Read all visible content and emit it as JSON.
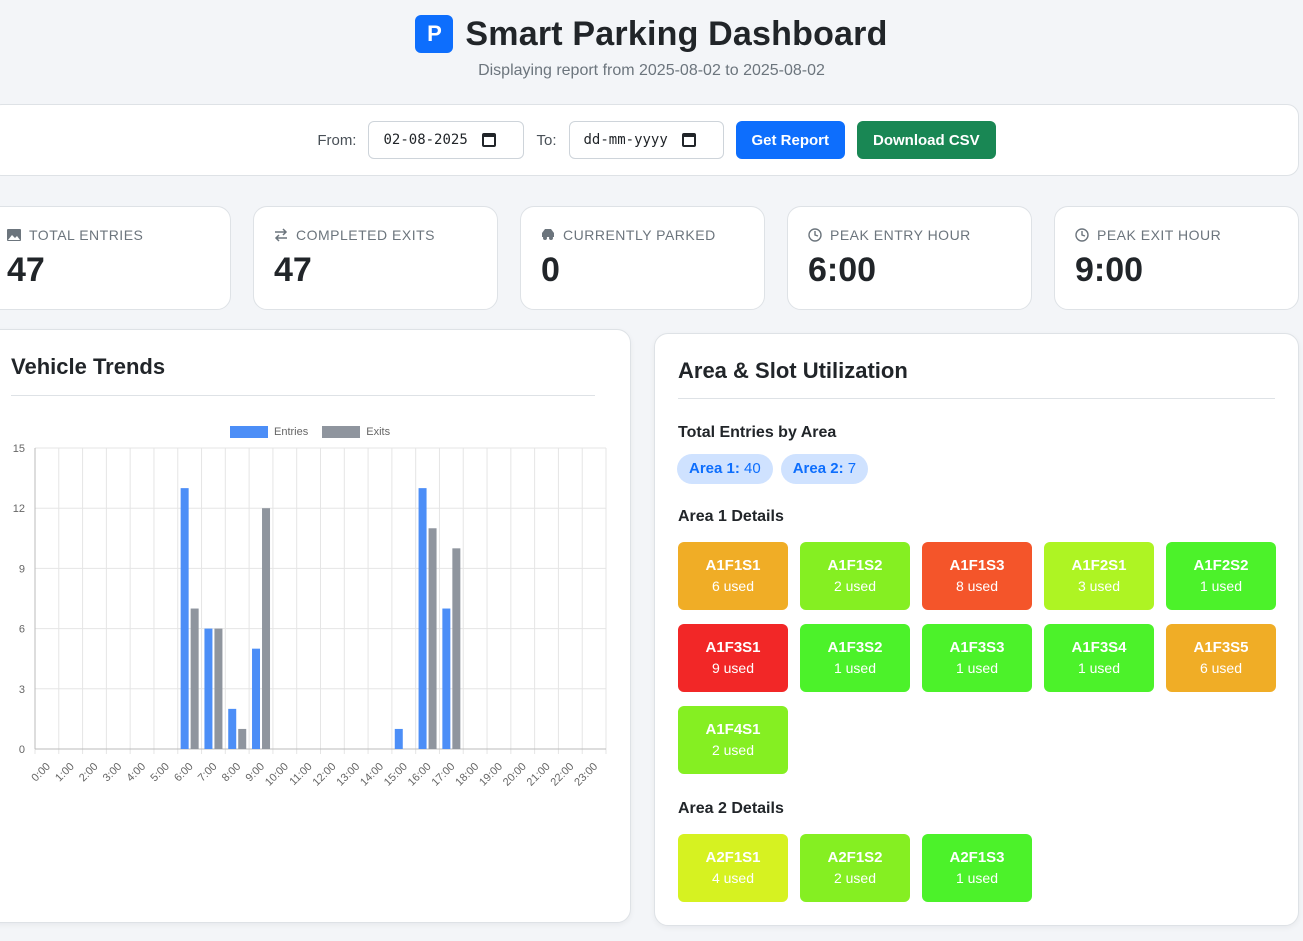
{
  "header": {
    "logo_letter": "P",
    "title": "Smart Parking Dashboard",
    "subtitle": "Displaying report from 2025-08-02 to 2025-08-02"
  },
  "controls": {
    "from_label": "From:",
    "from_value": "02-08-2025",
    "to_label": "To:",
    "to_placeholder": "dd-mm-yyyy",
    "get_report_label": "Get Report",
    "download_csv_label": "Download CSV"
  },
  "stats": [
    {
      "label": "TOTAL ENTRIES",
      "value": "47",
      "icon": "image-icon"
    },
    {
      "label": "COMPLETED EXITS",
      "value": "47",
      "icon": "arrows-exchange-icon"
    },
    {
      "label": "CURRENTLY PARKED",
      "value": "0",
      "icon": "car-icon"
    },
    {
      "label": "PEAK ENTRY HOUR",
      "value": "6:00",
      "icon": "clock-icon"
    },
    {
      "label": "PEAK EXIT HOUR",
      "value": "9:00",
      "icon": "clock-icon"
    }
  ],
  "trends": {
    "title": "Vehicle Trends"
  },
  "chart_data": {
    "type": "bar",
    "categories": [
      "0:00",
      "1:00",
      "2:00",
      "3:00",
      "4:00",
      "5:00",
      "6:00",
      "7:00",
      "8:00",
      "9:00",
      "10:00",
      "11:00",
      "12:00",
      "13:00",
      "14:00",
      "15:00",
      "16:00",
      "17:00",
      "18:00",
      "19:00",
      "20:00",
      "21:00",
      "22:00",
      "23:00"
    ],
    "series": [
      {
        "name": "Entries",
        "color": "#4c8ef7",
        "values": [
          0,
          0,
          0,
          0,
          0,
          0,
          13,
          6,
          2,
          5,
          0,
          0,
          0,
          0,
          0,
          1,
          13,
          7,
          0,
          0,
          0,
          0,
          0,
          0
        ]
      },
      {
        "name": "Exits",
        "color": "#8f959e",
        "values": [
          0,
          0,
          0,
          0,
          0,
          0,
          7,
          6,
          1,
          12,
          0,
          0,
          0,
          0,
          0,
          0,
          11,
          10,
          0,
          0,
          0,
          0,
          0,
          0
        ]
      }
    ],
    "y_ticks": [
      "0",
      "3",
      "6",
      "9",
      "12",
      "15"
    ],
    "ylim": [
      0,
      15
    ],
    "grid": true,
    "legend_position": "top-center"
  },
  "utilization": {
    "title": "Area & Slot Utilization",
    "total_entries_heading": "Total Entries by Area",
    "area_pills": [
      {
        "name": "Area 1:",
        "count": "40"
      },
      {
        "name": "Area 2:",
        "count": "7"
      }
    ],
    "area1_heading": "Area 1 Details",
    "area2_heading": "Area 2 Details",
    "area1_slots": [
      {
        "name": "A1F1S1",
        "used": "6 used",
        "color": "#f0ad26"
      },
      {
        "name": "A1F1S2",
        "used": "2 used",
        "color": "#85ef22"
      },
      {
        "name": "A1F1S3",
        "used": "8 used",
        "color": "#f4552a"
      },
      {
        "name": "A1F2S1",
        "used": "3 used",
        "color": "#aef423"
      },
      {
        "name": "A1F2S2",
        "used": "1 used",
        "color": "#4cf22a"
      },
      {
        "name": "A1F3S1",
        "used": "9 used",
        "color": "#f22727"
      },
      {
        "name": "A1F3S2",
        "used": "1 used",
        "color": "#4cf22a"
      },
      {
        "name": "A1F3S3",
        "used": "1 used",
        "color": "#4cf22a"
      },
      {
        "name": "A1F3S4",
        "used": "1 used",
        "color": "#4cf22a"
      },
      {
        "name": "A1F3S5",
        "used": "6 used",
        "color": "#f0ad26"
      },
      {
        "name": "A1F4S1",
        "used": "2 used",
        "color": "#85ef22"
      }
    ],
    "area2_slots": [
      {
        "name": "A2F1S1",
        "used": "4 used",
        "color": "#d6f221"
      },
      {
        "name": "A2F1S2",
        "used": "2 used",
        "color": "#85ef22"
      },
      {
        "name": "A2F1S3",
        "used": "1 used",
        "color": "#4cf22a"
      }
    ]
  }
}
